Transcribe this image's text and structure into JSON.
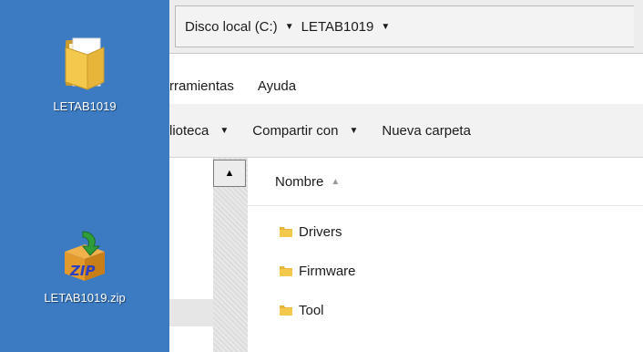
{
  "desktop": {
    "icons": [
      {
        "label": "LETAB1019",
        "icon": "folder-icon"
      },
      {
        "label": "LETAB1019.zip",
        "icon": "zip-archive-icon"
      }
    ]
  },
  "address_bar": {
    "crumbs": [
      "Disco local (C:)",
      "LETAB1019"
    ]
  },
  "menu": {
    "items": [
      "rramientas",
      "Ayuda"
    ]
  },
  "command_bar": {
    "items": [
      {
        "label": "lioteca",
        "dropdown": true
      },
      {
        "label": "Compartir con",
        "dropdown": true
      },
      {
        "label": "Nueva carpeta",
        "dropdown": false
      }
    ]
  },
  "file_list": {
    "column_header": "Nombre",
    "items": [
      "Drivers",
      "Firmware",
      "Tool"
    ]
  },
  "colors": {
    "desktop_bg": "#3c7bc2",
    "folder_yellow": "#f2c94c"
  }
}
